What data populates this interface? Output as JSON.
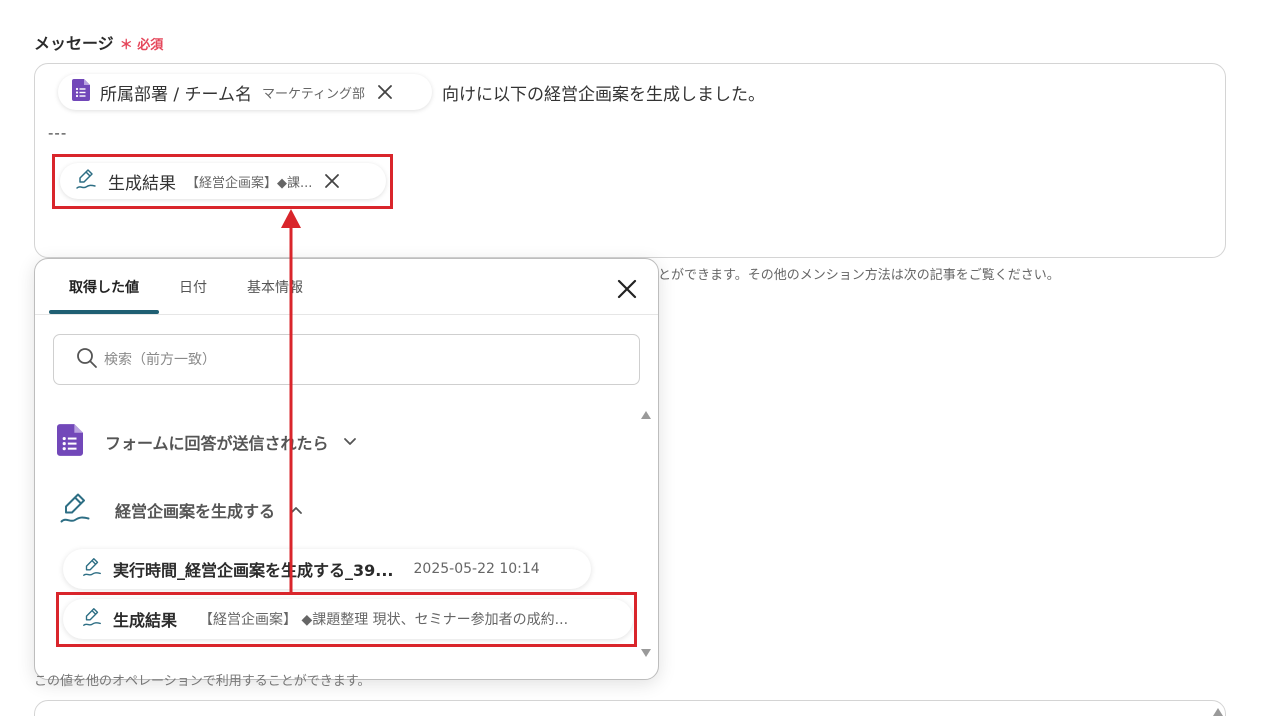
{
  "field": {
    "label": "メッセージ",
    "required_mark": "＊",
    "required_text": "必須"
  },
  "editor": {
    "chip1": {
      "icon": "google-forms-icon",
      "label": "所属部署 / チーム名",
      "value": "マーケティング部"
    },
    "after_text": "向けに以下の経営企画案を生成しました。",
    "separator": "---",
    "chip2": {
      "icon": "ai-pen-icon",
      "label": "生成結果",
      "value": "【経営企画案】◆課..."
    }
  },
  "hint_text": "とができます。その他のメンション方法は次の記事をご覧ください。",
  "popup": {
    "tabs": [
      {
        "label": "取得した値",
        "active": true
      },
      {
        "label": "日付",
        "active": false
      },
      {
        "label": "基本情報",
        "active": false
      }
    ],
    "search_placeholder": "検索（前方一致）",
    "groups": [
      {
        "icon": "google-forms-icon",
        "label": "フォームに回答が送信されたら",
        "expanded": false
      },
      {
        "icon": "ai-pen-icon",
        "label": "経営企画案を生成する",
        "expanded": true
      }
    ],
    "items": [
      {
        "title": "実行時間_経営企画案を生成する_39...",
        "meta": "2025-05-22 10:14"
      },
      {
        "title": "生成結果",
        "meta": "【経営企画案】 ◆課題整理 現状、セミナー参加者の成約..."
      }
    ]
  },
  "bottom_text": "この値を他のオペレーションで利用することができます。",
  "colors": {
    "accent_tab": "#1f5f73",
    "highlight": "#d9252b",
    "required": "#e5475b",
    "forms_purple": "#7248b9",
    "ai_icon": "#2d6e84"
  }
}
